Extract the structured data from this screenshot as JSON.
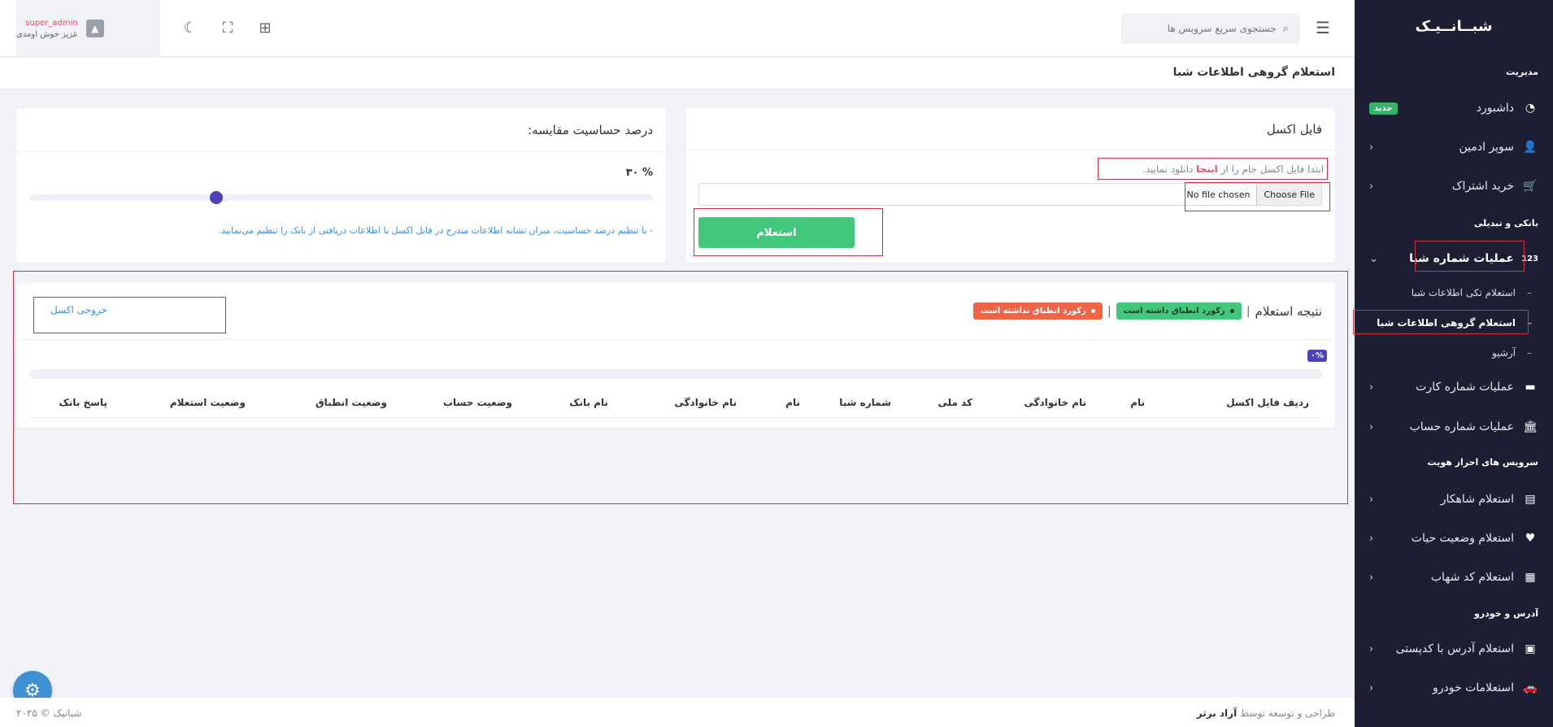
{
  "sidebar": {
    "logo": "شبــانــیـک",
    "sections": {
      "management": "مدیریت",
      "banking": "بانکی و تبدیلی",
      "identity": "سرویس های احراز هویت",
      "address": "آدرس و خودرو"
    },
    "items": {
      "dashboard": {
        "label": "داشبورد",
        "badge": "جدید"
      },
      "super_admin": {
        "label": "سوپر ادمین"
      },
      "subscription": {
        "label": "خرید اشتراک"
      },
      "sheba_ops": {
        "label": "عملیات شماره شبا",
        "icon_text": "123"
      },
      "card_ops": {
        "label": "عملیات شماره کارت"
      },
      "account_ops": {
        "label": "عملیات شماره حساب"
      },
      "shahkar": {
        "label": "استعلام شاهکار"
      },
      "life_status": {
        "label": "استعلام وضعیت حیات"
      },
      "shahab": {
        "label": "استعلام کد شهاب"
      },
      "postal": {
        "label": "استعلام آدرس با کدپستی"
      },
      "vehicle": {
        "label": "استعلامات خودرو"
      }
    },
    "sub_items": {
      "single": "استعلام تکی اطلاعات شبا",
      "group": "استعلام گروهی اطلاعات شبا",
      "archive": "آرشیو"
    }
  },
  "header": {
    "search_placeholder": "جستجوی سریع سرویس ها",
    "user_name": "super_admin",
    "greeting": "عزیز خوش اومدی"
  },
  "page": {
    "title": "استعلام گروهی اطلاعات شبا"
  },
  "excel_card": {
    "title": "فایل اکسل",
    "hint_before": "ابتدا فایل اکسل خام را از ",
    "hint_link": "اینجا",
    "hint_after": " دانلود نمایید.",
    "choose_file": "Choose File",
    "no_file": "No file chosen",
    "submit": "استعلام"
  },
  "sensitivity_card": {
    "title": "درصد حساسیت مقایسه:",
    "value_text": "% ۳۰",
    "value": 30,
    "note": "- با تنظیم درصد حساسیت، میزان تشابه اطلاعات مندرج در فایل اکسل با اطلاعات دریافتی از بانک را تنظیم می‌نمایید."
  },
  "results": {
    "title": "نتیجه استعلام",
    "sep": "|",
    "matched": "رکورد انطباق داشته است",
    "unmatched": "رکورد انطباق نداشته است",
    "export": "خروجی اکسل",
    "progress_badge": "۰%",
    "progress": 0,
    "columns": [
      "ردیف فایل اکسل",
      "نام",
      "نام خانوادگی",
      "کد ملی",
      "شماره شبا",
      "نام",
      "نام خانوادگی",
      "نام بانک",
      "وضعیت حساب",
      "وضعیت انطباق",
      "وضعیت استعلام",
      "پاسخ بانک"
    ]
  },
  "footer": {
    "design_prefix": "طراحی و توسعه توسط",
    "company": "آراد برتر",
    "copyright": "شبانیک © ۲۰۲۵"
  },
  "colors": {
    "sidebar_bg": "#1c1f33",
    "primary": "#4c44b6",
    "success": "#42c77d",
    "danger": "#f06548",
    "link": "#3f8fd3",
    "highlight_box": "#d3303f"
  }
}
